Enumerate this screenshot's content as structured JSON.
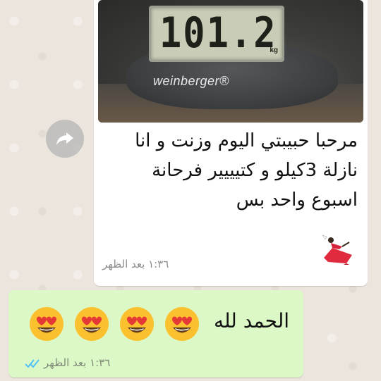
{
  "incoming_message": {
    "photo": {
      "display_reading": "101.2",
      "display_unit": "kg",
      "brand": "weinberger®"
    },
    "text": "مرحبا حبيبتي اليوم وزنت و انا نازلة 3كيلو و كتيييير فرحانة  اسبوع واحد بس",
    "emoji_icon": "dancer-icon",
    "time": "١:٣٦ بعد الظهر"
  },
  "outgoing_message": {
    "text": "الحمد لله",
    "emojis": [
      "heart-eyes-icon",
      "heart-eyes-icon",
      "heart-eyes-icon",
      "heart-eyes-icon"
    ],
    "time": "١:٣٦ بعد الظهر",
    "status_icon": "double-check-icon"
  },
  "colors": {
    "chat_background": "#e5ddd5",
    "incoming_bubble": "#ffffff",
    "outgoing_bubble": "#dcf8c6",
    "read_ticks": "#4fc3f7"
  }
}
